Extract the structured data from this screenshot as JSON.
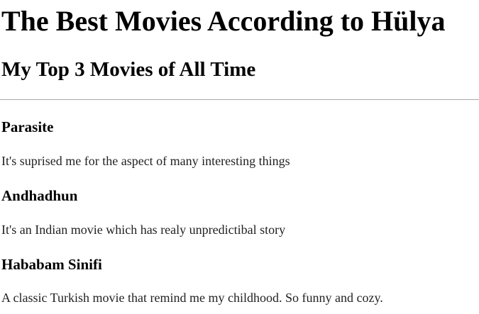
{
  "header": {
    "title": "The Best Movies According to Hülya",
    "subtitle": "My Top 3 Movies of All Time"
  },
  "movies": [
    {
      "title": "Parasite",
      "description": "It's suprised me for the aspect of many interesting things"
    },
    {
      "title": "Andhadhun",
      "description": "It's an Indian movie which has realy unpredictibal story"
    },
    {
      "title": "Hababam Sinifi",
      "description": "A classic Turkish movie that remind me my childhood. So funny and cozy."
    }
  ]
}
